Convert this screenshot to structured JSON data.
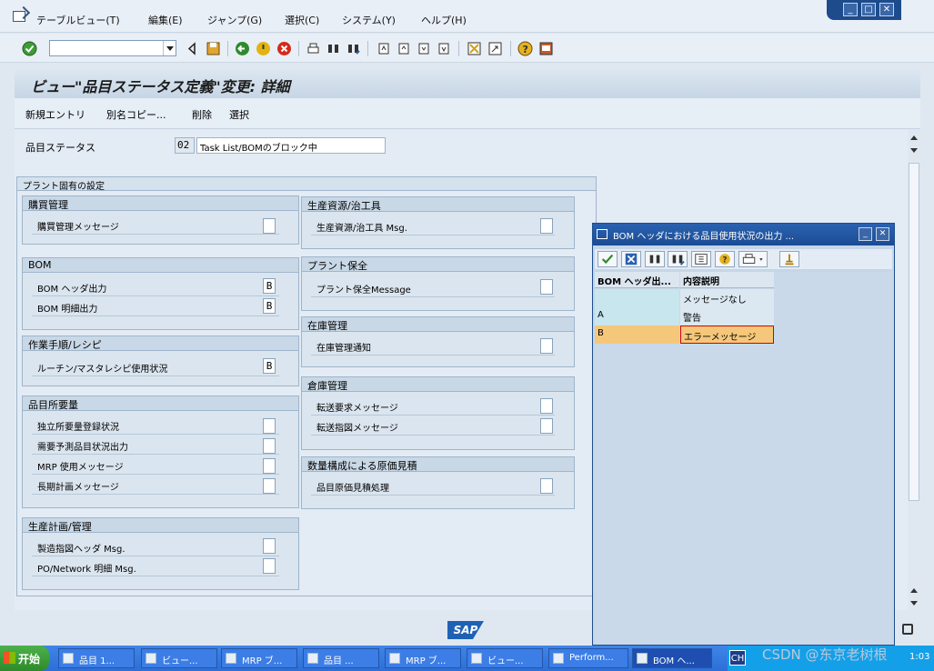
{
  "menubar": {
    "items": [
      "テーブルビュー(T)",
      "編集(E)",
      "ジャンプ(G)",
      "選択(C)",
      "システム(Y)",
      "ヘルプ(H)"
    ]
  },
  "window_controls": {
    "minimize": "_",
    "maximize": "□",
    "close": "✕"
  },
  "toolbar": {
    "command_field": "",
    "icons": [
      "enter-icon",
      "command-dropdown-icon",
      "collapse-icon",
      "save-icon",
      "back-icon",
      "exit-icon",
      "cancel-icon",
      "print-icon",
      "find-icon",
      "find-next-icon",
      "first-page-icon",
      "prev-page-icon",
      "next-page-icon",
      "last-page-icon",
      "create-session-icon",
      "shortcut-icon",
      "help-icon",
      "layout-icon"
    ]
  },
  "title": "ビュー\"品目ステータス定義\"変更: 詳細",
  "app_toolbar": {
    "new_entries": "新規エントリ",
    "copy_as": "別名コピー...",
    "delete": "削除",
    "select": "選択"
  },
  "key": {
    "label": "品目ステータス",
    "code": "02",
    "text": "Task List/BOMのブロック中"
  },
  "plant_group_title": "プラント固有の設定",
  "groups": {
    "purchasing": {
      "title": "購買管理",
      "rows": [
        {
          "label": "購買管理メッセージ",
          "value": ""
        }
      ]
    },
    "bom": {
      "title": "BOM",
      "rows": [
        {
          "label": "BOM ヘッダ出力",
          "value": "B"
        },
        {
          "label": "BOM 明細出力",
          "value": "B"
        }
      ]
    },
    "routing": {
      "title": "作業手順/レシピ",
      "rows": [
        {
          "label": "ルーチン/マスタレシピ使用状況",
          "value": "B"
        }
      ]
    },
    "mrp": {
      "title": "品目所要量",
      "rows": [
        {
          "label": "独立所要量登録状況",
          "value": ""
        },
        {
          "label": "需要予測品目状況出力",
          "value": ""
        },
        {
          "label": "MRP 使用メッセージ",
          "value": ""
        },
        {
          "label": "長期計画メッセージ",
          "value": ""
        }
      ]
    },
    "production": {
      "title": "生産計画/管理",
      "rows": [
        {
          "label": "製造指図ヘッダ Msg.",
          "value": ""
        },
        {
          "label": "PO/Network 明細 Msg.",
          "value": ""
        }
      ]
    },
    "prt": {
      "title": "生産資源/治工具",
      "rows": [
        {
          "label": "生産資源/治工具 Msg.",
          "value": ""
        }
      ]
    },
    "pm": {
      "title": "プラント保全",
      "rows": [
        {
          "label": "プラント保全Message",
          "value": ""
        }
      ]
    },
    "inventory": {
      "title": "在庫管理",
      "rows": [
        {
          "label": "在庫管理通知",
          "value": ""
        }
      ]
    },
    "warehouse": {
      "title": "倉庫管理",
      "rows": [
        {
          "label": "転送要求メッセージ",
          "value": ""
        },
        {
          "label": "転送指図メッセージ",
          "value": ""
        }
      ]
    },
    "costing": {
      "title": "数量構成による原価見積",
      "rows": [
        {
          "label": "品目原価見積処理",
          "value": ""
        }
      ]
    }
  },
  "logo_text": "SAP",
  "popup": {
    "title": "BOM ヘッダにおける品目使用状況の出力 ...",
    "columns": [
      "BOM ヘッダ出...",
      "内容説明"
    ],
    "rows": [
      {
        "key": "",
        "text": "メッセージなし"
      },
      {
        "key": "A",
        "text": "警告"
      },
      {
        "key": "B",
        "text": "エラーメッセージ"
      }
    ],
    "selected_row": "B"
  },
  "taskbar": {
    "start": "开始",
    "tasks": [
      "品目 1...",
      "ビュー...",
      "MRP ブ...",
      "品目 ...",
      "MRP ブ...",
      "ビュー...",
      "Perform...",
      "BOM ヘ..."
    ],
    "lang": "CH",
    "clock": "1:03"
  },
  "watermark": "CSDN @东京老树根",
  "colors": {
    "accent": "#1e4d8f",
    "selected_row": "#f5c77a",
    "selected_text_border": "#d40000"
  }
}
